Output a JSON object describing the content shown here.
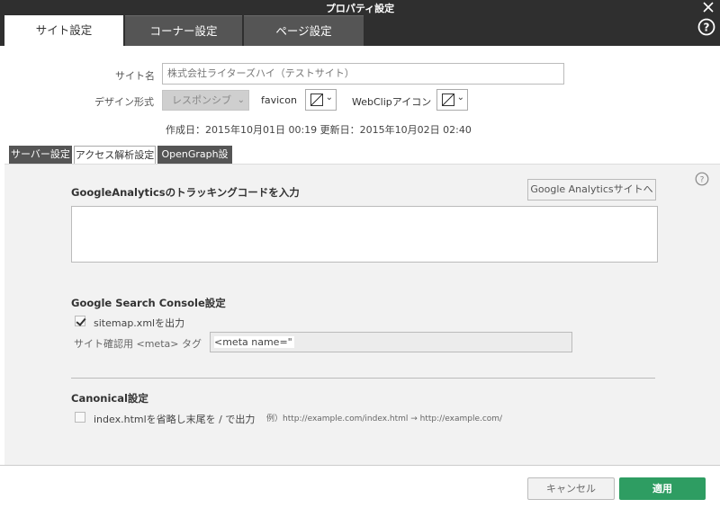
{
  "window": {
    "title": "プロパティ設定"
  },
  "tabs": [
    "サイト設定",
    "コーナー設定",
    "ページ設定"
  ],
  "site": {
    "name_label": "サイト名",
    "name_value": "株式会社ライターズハイ（テストサイト）",
    "design_label": "デザイン形式",
    "design_value": "レスポンシブ",
    "favicon_label": "favicon",
    "webclip_label": "WebClipアイコン",
    "dates": "作成日：2015年10月01日 00:19 更新日：2015年10月02日 02:40"
  },
  "subtabs": [
    "サーバー設定",
    "アクセス解析設定",
    "OpenGraph設定"
  ],
  "analytics": {
    "title": "GoogleAnalyticsのトラッキングコードを入力",
    "site_button": "Google Analyticsサイトへ",
    "code_value": ""
  },
  "search_console": {
    "title": "Google Search Console設定",
    "sitemap_label": "sitemap.xmlを出力",
    "sitemap_checked": true,
    "meta_label": "サイト確認用 <meta> タグ",
    "meta_value": "<meta name=\""
  },
  "canonical": {
    "title": "Canonical設定",
    "index_label": "index.htmlを省略し末尾を / で出力",
    "index_checked": false,
    "example": "例）http://example.com/index.html → http://example.com/"
  },
  "footer": {
    "cancel": "キャンセル",
    "apply": "適用"
  },
  "colors": {
    "titlebar": "#2f2f2f",
    "apply": "#2e9d62",
    "panel": "#f2f2f2"
  },
  "icons": {
    "close": "close-icon",
    "help": "help-icon",
    "dropdown": "chevron-down-icon",
    "empty_image": "no-image-icon"
  }
}
